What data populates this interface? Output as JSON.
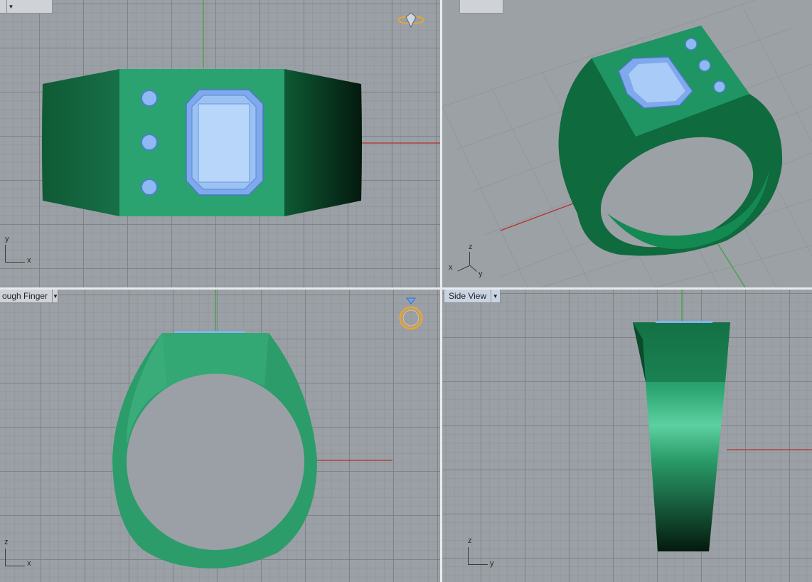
{
  "viewports": {
    "top": {
      "title": "",
      "axes": {
        "v": "y",
        "h": "x"
      }
    },
    "perspective": {
      "title": "",
      "axes": {
        "v": "z",
        "h": "y",
        "d": "x"
      }
    },
    "front": {
      "title": "ough Finger",
      "axes": {
        "v": "z",
        "h": "x"
      }
    },
    "right": {
      "title": "Side View",
      "axes": {
        "v": "z",
        "h": "y"
      }
    }
  },
  "icons": {
    "top_badge": "diamond-icon",
    "front_badge": "ring-icon"
  },
  "colors": {
    "ring_green": "#1f8a5c",
    "ring_dark": "#0c4a2c",
    "gem_blue": "#8fb9f2",
    "x_axis": "#b4302d",
    "y_axis": "#3da23a",
    "badge_gold": "#e5a53a"
  }
}
